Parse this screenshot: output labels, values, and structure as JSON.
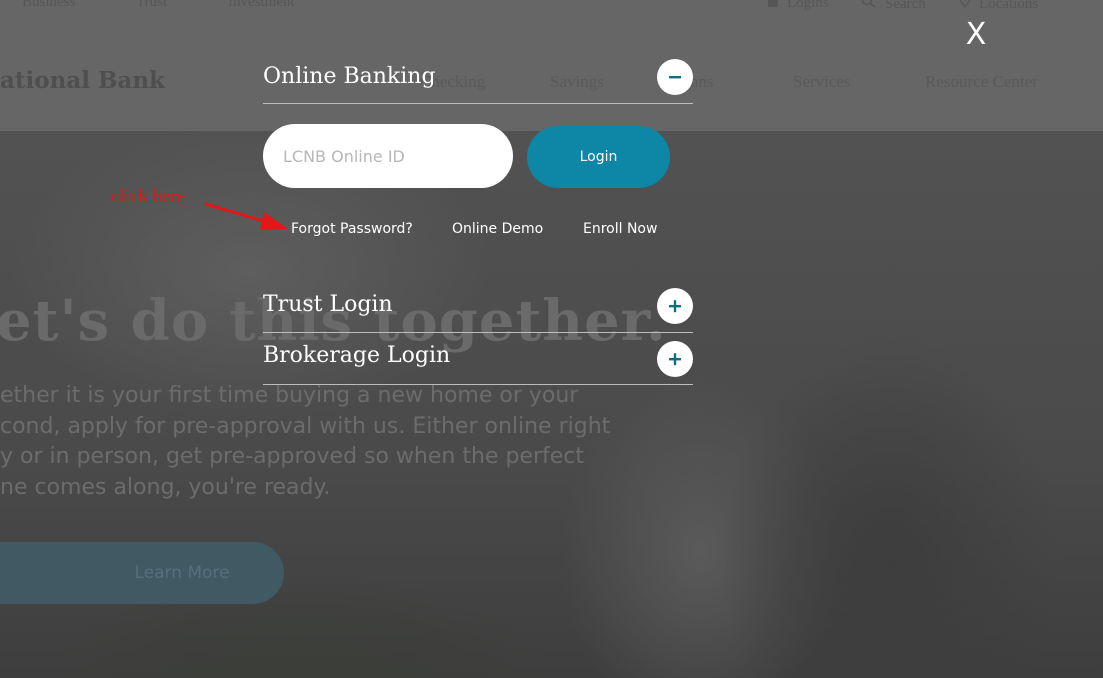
{
  "background": {
    "top_links": [
      "Business",
      "Trust",
      "Investment"
    ],
    "utility_links": [
      {
        "label": "Logins",
        "icon": "lock-icon"
      },
      {
        "label": "Search",
        "icon": "search-icon"
      },
      {
        "label": "Locations",
        "icon": "map-pin-icon"
      }
    ],
    "brand_name": "ational Bank",
    "nav_items": [
      "Checking",
      "Savings",
      "Loans",
      "Services",
      "Resource Center"
    ],
    "hero": {
      "headline": "et's do this together.",
      "paragraph_lines": [
        "ether it is your first time buying a new home or your",
        "cond, apply for pre-approval with us. Either online right",
        "y or in person, get pre-approved so when the perfect",
        "ne comes along, you're ready."
      ],
      "cta_label": "Learn More"
    }
  },
  "modal": {
    "close_label": "X",
    "online_banking": {
      "title": "Online Banking",
      "toggle_icon": "minus-icon",
      "id_placeholder": "LCNB Online ID",
      "login_label": "Login",
      "links": {
        "forgot_password": "Forgot Password?",
        "online_demo": "Online Demo",
        "enroll_now": "Enroll Now"
      }
    },
    "trust_login": {
      "title": "Trust Login",
      "toggle_icon": "plus-icon"
    },
    "brokerage_login": {
      "title": "Brokerage Login",
      "toggle_icon": "plus-icon"
    }
  },
  "annotation": {
    "text": "click here",
    "color": "#e01818"
  },
  "colors": {
    "accent": "#0e86a6",
    "icon_teal": "#0f6e82",
    "overlay": "#4f4f4f"
  }
}
